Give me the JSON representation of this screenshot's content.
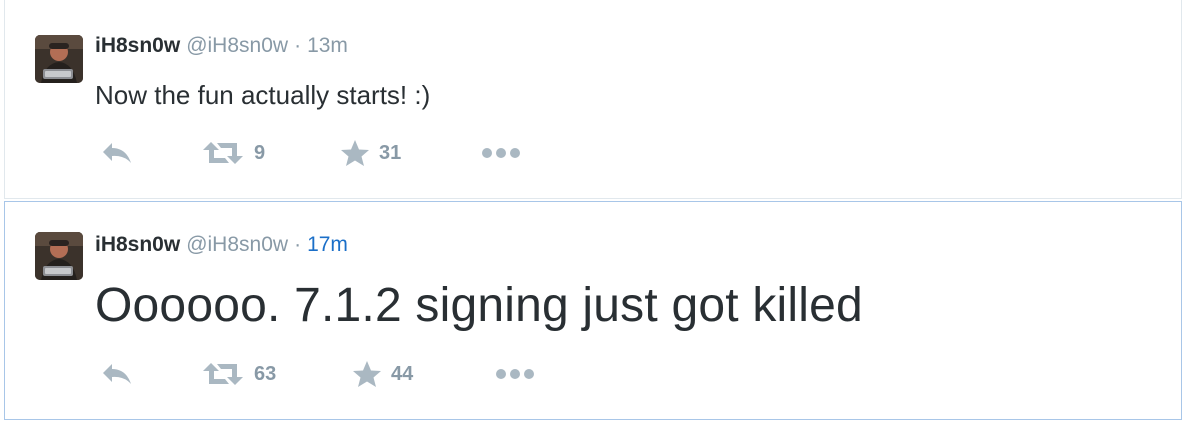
{
  "colors": {
    "name": "#292f33",
    "muted": "#8899a6",
    "link_time": "#1b6fc8",
    "selected_border": "#a8c6e8",
    "divider": "#e1e8ed",
    "icon": "#aab8c2"
  },
  "tweets": [
    {
      "fullname": "iH8sn0w",
      "username": "@iH8sn0w",
      "separator": "·",
      "time": "13m",
      "text": "Now the fun actually starts! :)",
      "retweets": "9",
      "favorites": "31",
      "icons": [
        "reply-icon",
        "retweet-icon",
        "favorite-icon",
        "more-icon"
      ]
    },
    {
      "fullname": "iH8sn0w",
      "username": "@iH8sn0w",
      "separator": "·",
      "time": "17m",
      "text": "Oooooo. 7.1.2 signing just got killed",
      "retweets": "63",
      "favorites": "44",
      "icons": [
        "reply-icon",
        "retweet-icon",
        "favorite-icon",
        "more-icon"
      ]
    }
  ]
}
